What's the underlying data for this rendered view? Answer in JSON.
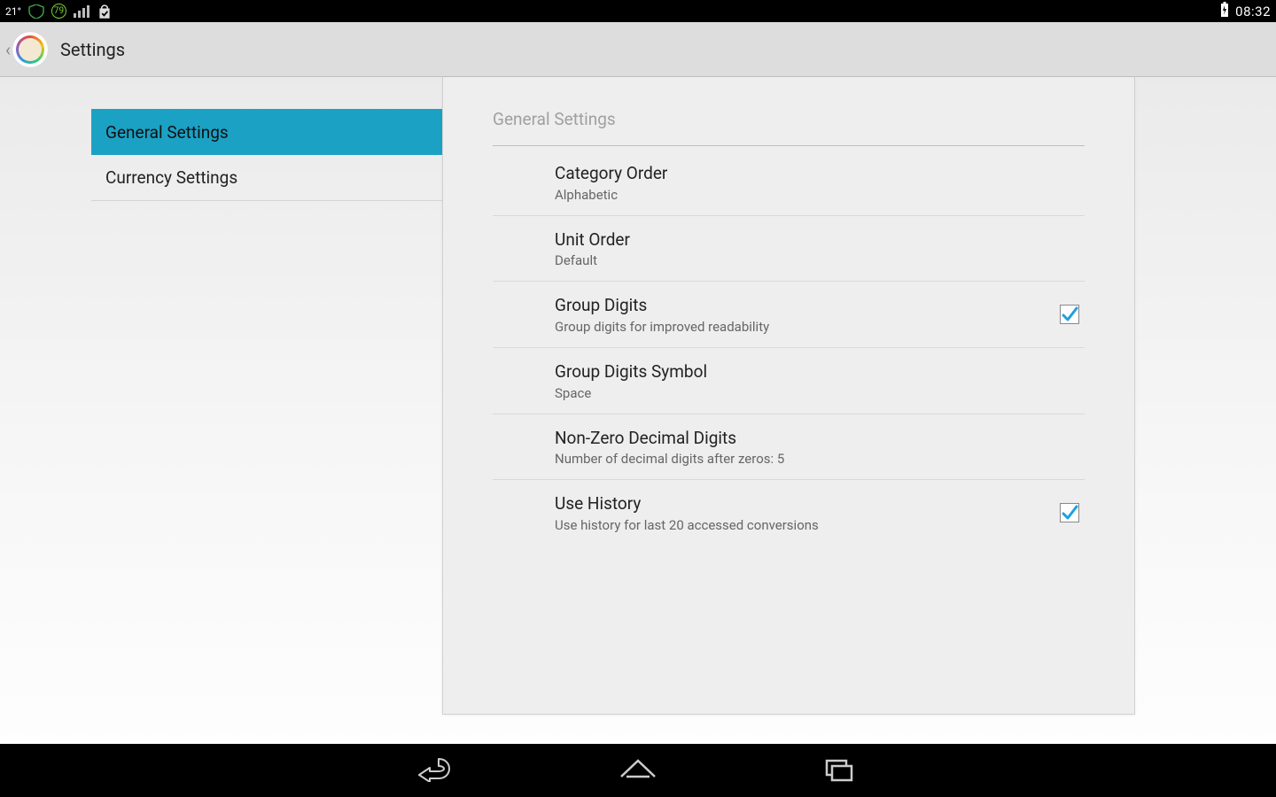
{
  "statusbar": {
    "temperature": "21°",
    "badge_number": "79",
    "clock": "08:32"
  },
  "actionbar": {
    "title": "Settings"
  },
  "sidebar": {
    "items": [
      {
        "label": "General Settings",
        "selected": true
      },
      {
        "label": "Currency Settings",
        "selected": false
      }
    ]
  },
  "panel": {
    "header": "General Settings",
    "prefs": [
      {
        "title": "Category Order",
        "subtitle": "Alphabetic",
        "checkbox": null
      },
      {
        "title": "Unit Order",
        "subtitle": "Default",
        "checkbox": null
      },
      {
        "title": "Group Digits",
        "subtitle": "Group digits for improved readability",
        "checkbox": true
      },
      {
        "title": "Group Digits Symbol",
        "subtitle": "Space",
        "checkbox": null
      },
      {
        "title": "Non-Zero Decimal Digits",
        "subtitle": "Number of decimal digits after zeros: 5",
        "checkbox": null
      },
      {
        "title": "Use History",
        "subtitle": "Use history for last 20 accessed conversions",
        "checkbox": true
      }
    ]
  },
  "colors": {
    "accent": "#1ba1c4",
    "check": "#1e9fe0"
  }
}
